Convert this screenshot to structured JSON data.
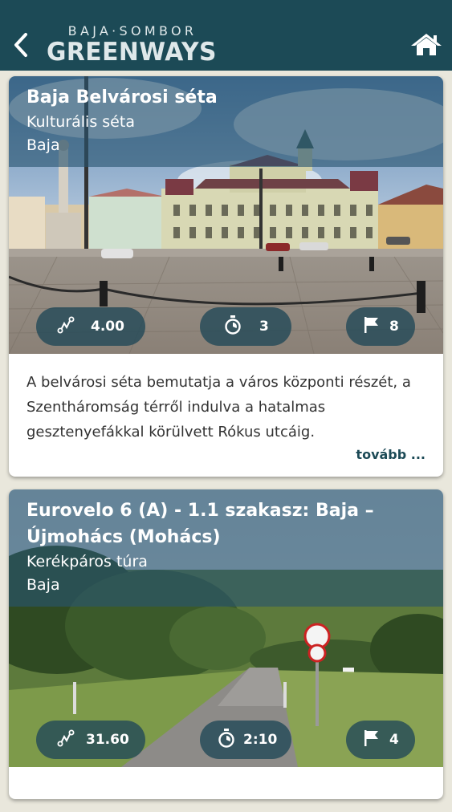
{
  "header": {
    "logo_top": "BAJA·SOMBOR",
    "logo_main": "GREENWAYS",
    "back_icon": "chevron-left-icon",
    "home_icon": "home-icon",
    "bar_color": "#1c4a56"
  },
  "cards": [
    {
      "title": "Baja Belvárosi séta",
      "type": "Kulturális séta",
      "location": "Baja",
      "distance": "4.00",
      "duration": "3",
      "stops": "8",
      "description": "A belvárosi séta bemutatja a város központi részét, a Szentháromság térről indulva a hatalmas gesztenyefákkal körülvett Rókus utcáig.",
      "more_label": "tovább ..."
    },
    {
      "title": "Eurovelo 6 (A) - 1.1 szakasz: Baja – Újmohács (Mohács)",
      "type": "Kerékpáros túra",
      "location": "Baja",
      "distance": "31.60",
      "duration": "2:10",
      "stops": "4"
    }
  ]
}
